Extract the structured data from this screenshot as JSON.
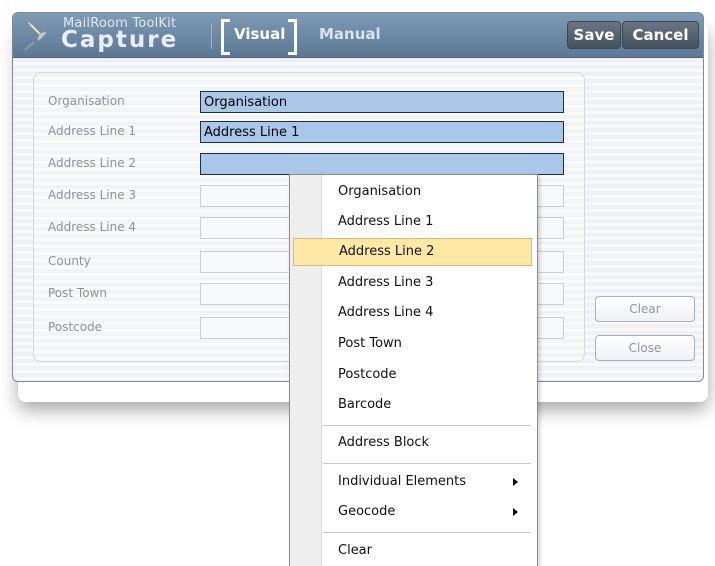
{
  "header": {
    "brand_small": "MailRoom ToolKit",
    "brand_large": "Capture",
    "tab_visual": "Visual",
    "tab_manual": "Manual",
    "save_label": "Save",
    "cancel_label": "Cancel",
    "icon": "pushpin-icon"
  },
  "form": {
    "fields": [
      {
        "label": "Organisation",
        "value": "Organisation"
      },
      {
        "label": "Address Line 1",
        "value": "Address Line 1"
      },
      {
        "label": "Address Line 2",
        "value": ""
      },
      {
        "label": "Address Line 3",
        "value": ""
      },
      {
        "label": "Address Line 4",
        "value": ""
      },
      {
        "label": "County",
        "value": ""
      },
      {
        "label": "Post Town",
        "value": ""
      },
      {
        "label": "Postcode",
        "value": ""
      }
    ],
    "clear_label": "Clear",
    "close_label": "Close"
  },
  "context_menu": {
    "items": [
      "Organisation",
      "Address Line 1",
      "Address Line 2",
      "Address Line 3",
      "Address Line 4",
      "Post Town",
      "Postcode",
      "Barcode",
      "Address Block",
      "Individual Elements",
      "Geocode",
      "Clear"
    ],
    "highlighted": "Address Line 2"
  },
  "colors": {
    "header": "#5b7895",
    "active_field": "#a9c7e8",
    "menu_highlight": "#fde9a5"
  }
}
